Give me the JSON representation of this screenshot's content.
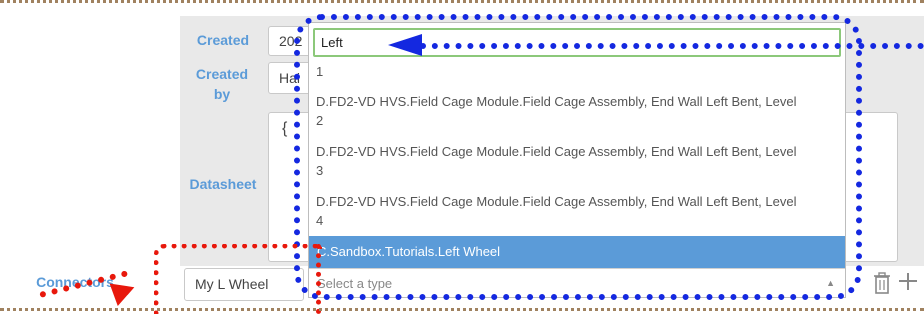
{
  "form": {
    "created_label": "Created",
    "created_value": "202",
    "created_by_label": "Created by",
    "created_by_value": "Hai",
    "datasheet_label": "Datasheet",
    "datasheet_value": "{",
    "connectors_label": "Connectors",
    "connector_value": "My L Wheel"
  },
  "dropdown": {
    "search_value": "Left",
    "items": [
      "1",
      "D.FD2-VD HVS.Field Cage Module.Field Cage Assembly, End Wall Left Bent, Level",
      "2",
      "D.FD2-VD HVS.Field Cage Module.Field Cage Assembly, End Wall Left Bent, Level",
      "3",
      "D.FD2-VD HVS.Field Cage Module.Field Cage Assembly, End Wall Left Bent, Level",
      "4"
    ],
    "selected_item": "C.Sandbox.Tutorials.Left Wheel",
    "type_placeholder": "Select a type"
  },
  "icons": {
    "trash": "trash-icon",
    "plus": "plus-icon",
    "caret": "caret-up-icon"
  },
  "colors": {
    "label_blue": "#5b9bd8",
    "selected_bg": "#5b9bd8",
    "annotation_blue": "#1428e0",
    "annotation_red": "#e8180c",
    "search_border": "#8cc87a"
  }
}
